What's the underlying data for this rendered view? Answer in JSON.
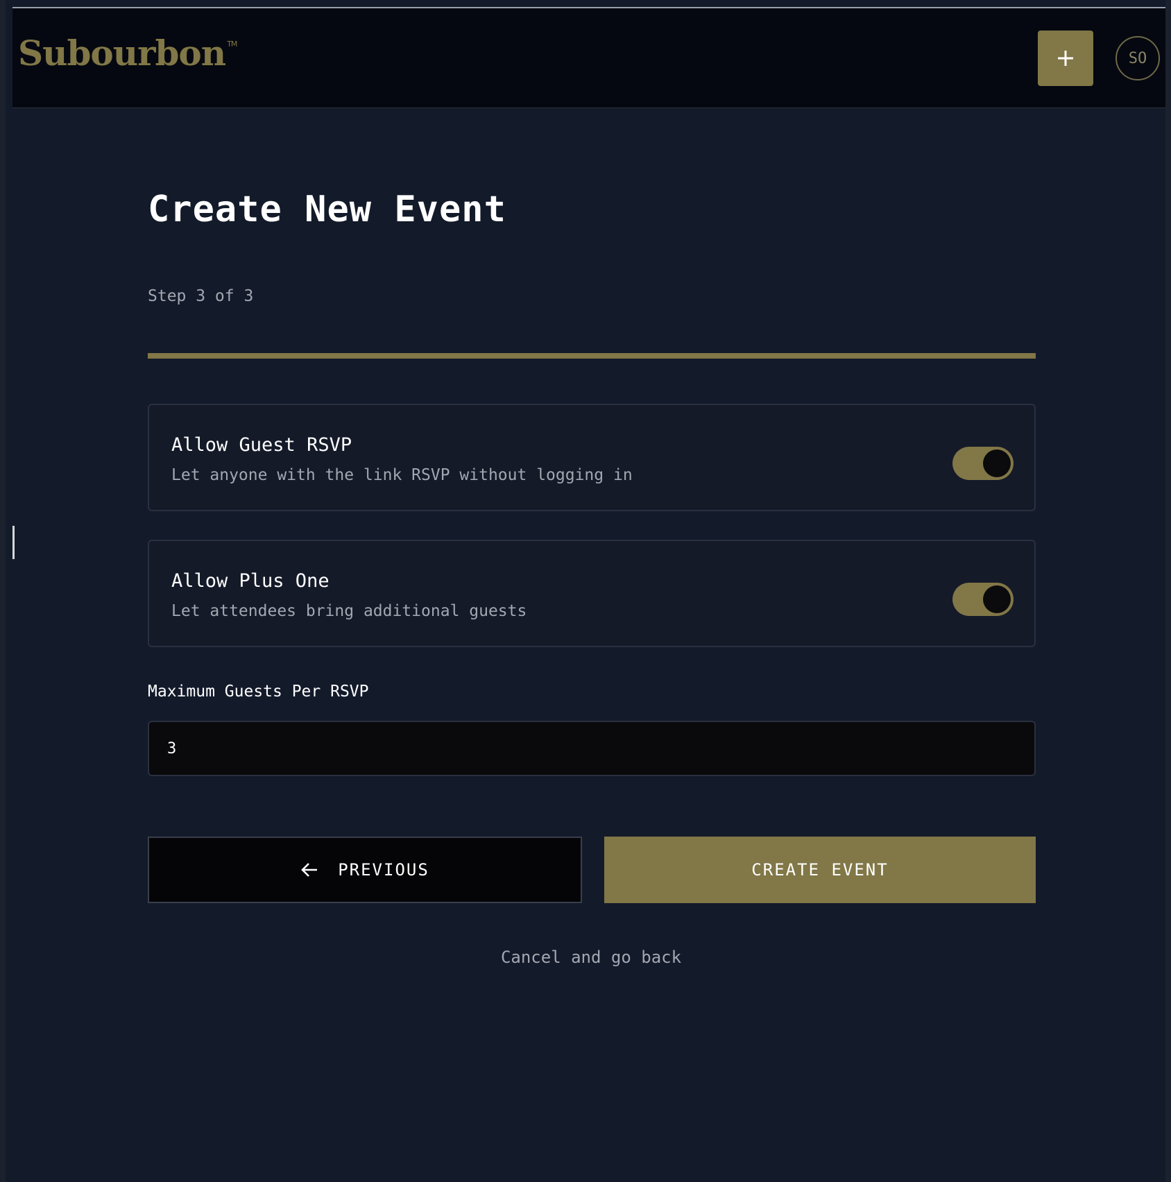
{
  "brand": {
    "name": "Subourbon",
    "trademark": "TM",
    "accent_color": "#817747"
  },
  "header": {
    "add_icon": "plus-icon",
    "avatar_initials": "SO"
  },
  "page": {
    "title": "Create New Event",
    "step_text": "Step 3 of 3",
    "progress_percent": 100
  },
  "settings": [
    {
      "title": "Allow Guest RSVP",
      "description": "Let anyone with the link RSVP without logging in",
      "enabled": true
    },
    {
      "title": "Allow Plus One",
      "description": "Let attendees bring additional guests",
      "enabled": true
    }
  ],
  "max_guests": {
    "label": "Maximum Guests Per RSVP",
    "value": "3"
  },
  "actions": {
    "previous_label": "PREVIOUS",
    "previous_icon": "arrow-left-icon",
    "create_label": "CREATE EVENT",
    "cancel_label": "Cancel and go back"
  }
}
